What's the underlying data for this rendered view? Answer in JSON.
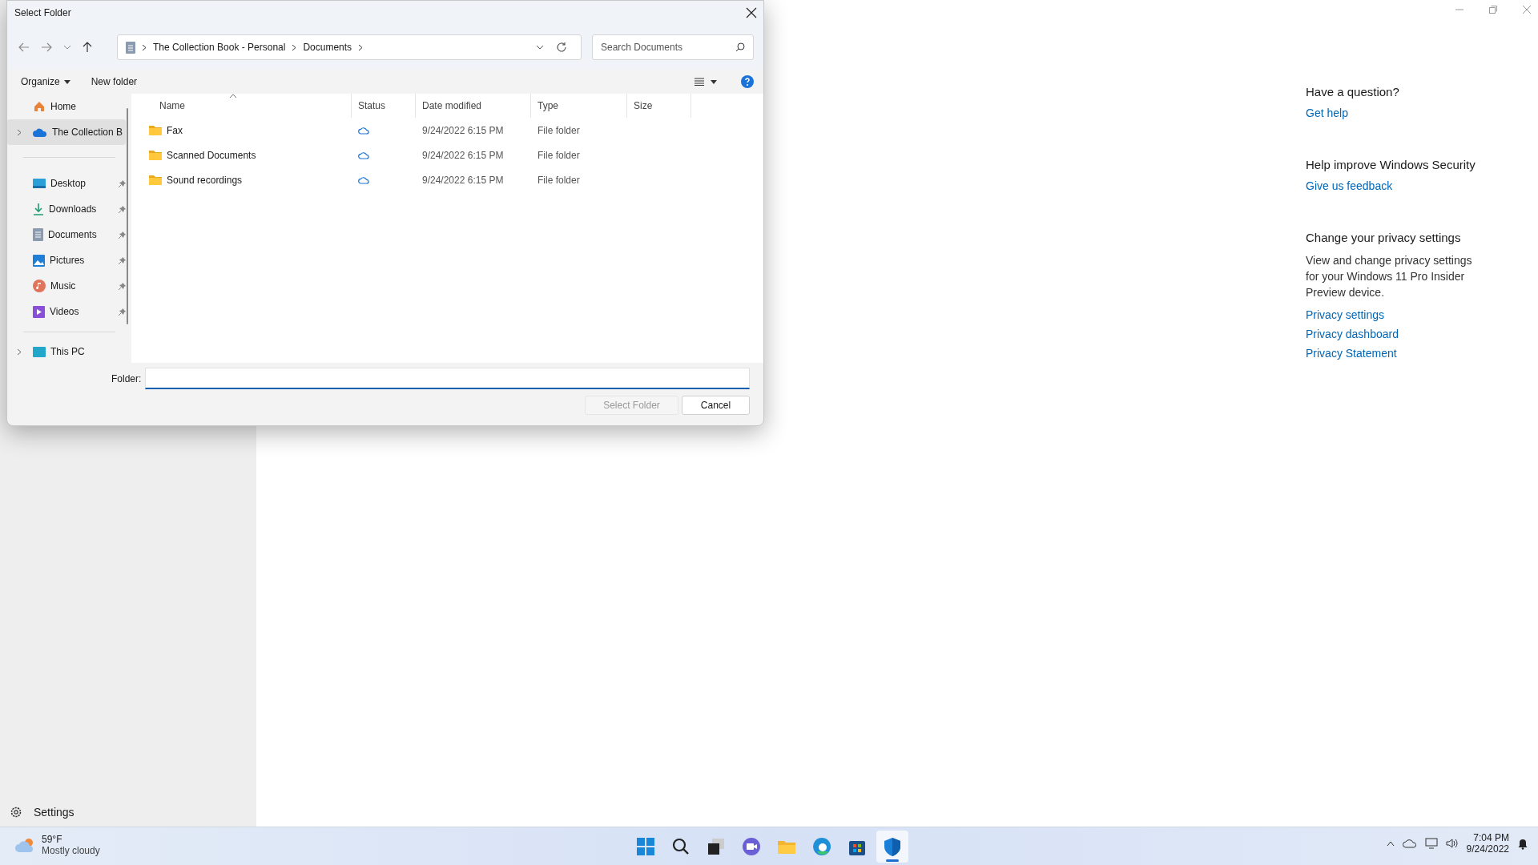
{
  "dialog": {
    "title": "Select Folder",
    "breadcrumb": [
      "The Collection Book - Personal",
      "Documents"
    ],
    "search": {
      "placeholder": "Search Documents"
    },
    "toolbar": [
      "Organize",
      "New folder"
    ],
    "nav_sections": [
      [
        {
          "label": "Home",
          "kind": "home",
          "selected": false,
          "pinned": false,
          "expandable": false
        },
        {
          "label": "The Collection B",
          "kind": "cloud",
          "selected": true,
          "pinned": false,
          "expandable": true
        }
      ],
      [
        {
          "label": "Desktop",
          "kind": "desktop",
          "selected": false,
          "pinned": true,
          "expandable": false
        },
        {
          "label": "Downloads",
          "kind": "downloads",
          "selected": false,
          "pinned": true,
          "expandable": false
        },
        {
          "label": "Documents",
          "kind": "documents",
          "selected": false,
          "pinned": true,
          "expandable": false
        },
        {
          "label": "Pictures",
          "kind": "pictures",
          "selected": false,
          "pinned": true,
          "expandable": false
        },
        {
          "label": "Music",
          "kind": "music",
          "selected": false,
          "pinned": true,
          "expandable": false
        },
        {
          "label": "Videos",
          "kind": "videos",
          "selected": false,
          "pinned": true,
          "expandable": false
        }
      ],
      [
        {
          "label": "This PC",
          "kind": "pc",
          "selected": false,
          "pinned": false,
          "expandable": true
        }
      ]
    ],
    "columns": [
      "Name",
      "Status",
      "Date modified",
      "Type",
      "Size"
    ],
    "rows": [
      {
        "name": "Fax",
        "date": "9/24/2022 6:15 PM",
        "type": "File folder"
      },
      {
        "name": "Scanned Documents",
        "date": "9/24/2022 6:15 PM",
        "type": "File folder"
      },
      {
        "name": "Sound recordings",
        "date": "9/24/2022 6:15 PM",
        "type": "File folder"
      }
    ],
    "folder_label": "Folder:",
    "buttons": [
      {
        "label": "Select Folder",
        "disabled": true
      },
      {
        "label": "Cancel",
        "disabled": false
      }
    ]
  },
  "sidebar": {
    "settings": "Settings"
  },
  "help": [
    {
      "heading": "Have a question?",
      "links": [
        "Get help"
      ]
    },
    {
      "heading": "Help improve Windows Security",
      "links": [
        "Give us feedback"
      ]
    },
    {
      "heading": "Change your privacy settings",
      "text": "View and change privacy settings for your Windows 11 Pro Insider Preview device.",
      "links": [
        "Privacy settings",
        "Privacy dashboard",
        "Privacy Statement"
      ]
    }
  ],
  "taskbar": {
    "weather": {
      "temp": "59°F",
      "condition": "Mostly cloudy"
    },
    "apps": [
      {
        "kind": "start",
        "active": false
      },
      {
        "kind": "search",
        "active": false
      },
      {
        "kind": "taskview",
        "active": false
      },
      {
        "kind": "chat",
        "active": false
      },
      {
        "kind": "explorer",
        "active": false
      },
      {
        "kind": "edge",
        "active": false
      },
      {
        "kind": "store",
        "active": false
      },
      {
        "kind": "security",
        "active": true
      }
    ],
    "time": "7:04 PM",
    "date": "9/24/2022"
  }
}
